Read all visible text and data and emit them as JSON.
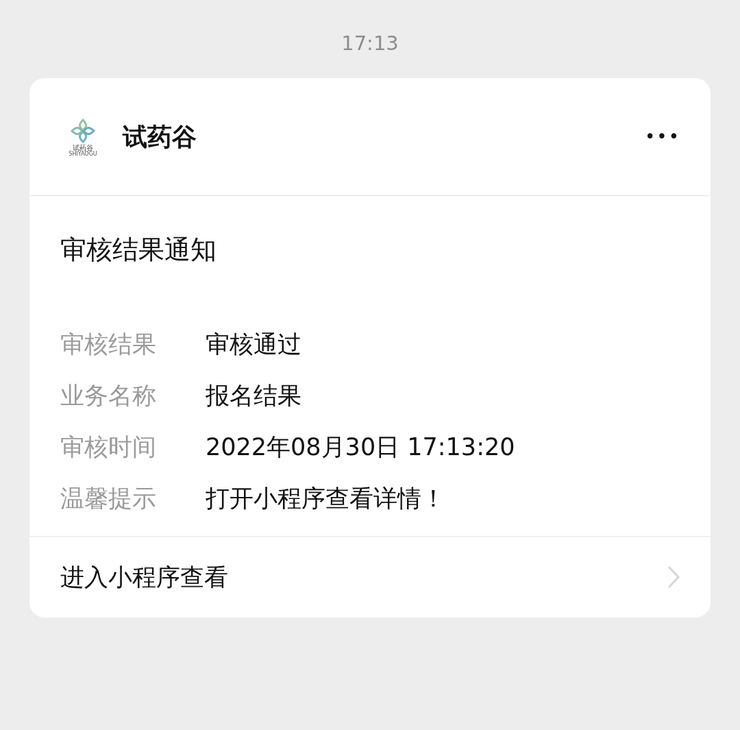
{
  "time": "17:13",
  "card": {
    "account": {
      "logo_text": "试药谷",
      "logo_subtext": "SHIYAOGU",
      "name": "试药谷",
      "more_icon": "•••"
    },
    "title": "审核结果通知",
    "fields": [
      {
        "label": "审核结果",
        "value": "审核通过"
      },
      {
        "label": "业务名称",
        "value": "报名结果"
      },
      {
        "label": "审核时间",
        "value": "2022年08月30日 17:13:20"
      },
      {
        "label": "温馨提示",
        "value": "打开小程序查看详情！"
      }
    ],
    "footer_link": "进入小程序查看"
  }
}
